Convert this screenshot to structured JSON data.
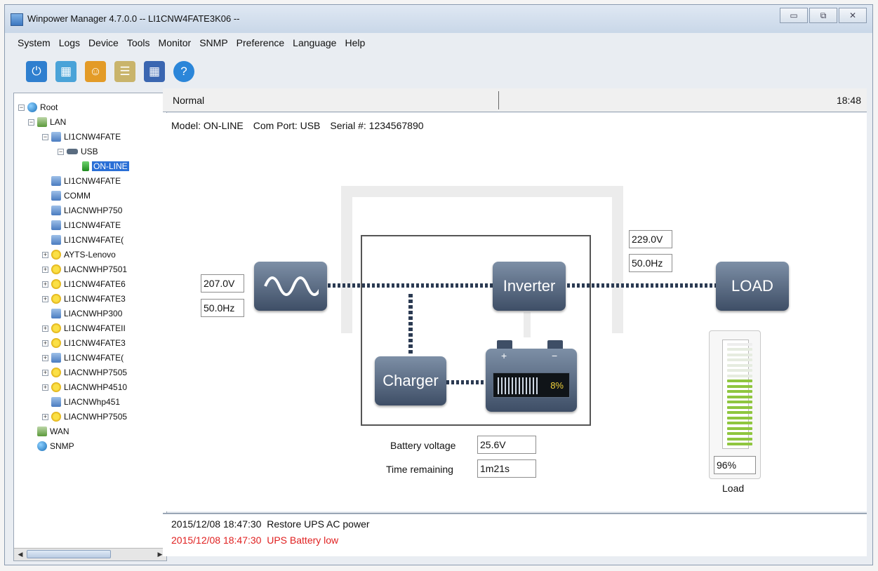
{
  "window": {
    "title": "Winpower Manager 4.7.0.0 -- LI1CNW4FATE3K06 --",
    "controls": [
      "▭",
      "⧉",
      "✕"
    ]
  },
  "menu": {
    "items": [
      "System",
      "Logs",
      "Device",
      "Tools",
      "Monitor",
      "SNMP",
      "Preference",
      "Language",
      "Help"
    ]
  },
  "toolbar": {
    "buttons": [
      {
        "icon": "power-icon",
        "glyph": "⏻",
        "color": "#2f7fcf"
      },
      {
        "icon": "calendar-clock-icon",
        "glyph": "▦",
        "color": "#4aa3d8"
      },
      {
        "icon": "user-icon",
        "glyph": "☺",
        "color": "#e39b27"
      },
      {
        "icon": "list-icon",
        "glyph": "☰",
        "color": "#c9b46b"
      },
      {
        "icon": "grid-icon",
        "glyph": "▦",
        "color": "#3a66b1"
      },
      {
        "icon": "help-icon",
        "glyph": "?",
        "color": "#2b86d9"
      }
    ]
  },
  "tree": {
    "nodes": [
      {
        "label": "Root",
        "exp": "⊟",
        "icon": "globe"
      },
      {
        "label": "LAN",
        "exp": "⊟",
        "icon": "net"
      },
      {
        "label": "LI1CNW4FATE",
        "exp": "⊟",
        "icon": "pc"
      },
      {
        "label": "USB",
        "exp": "⊟",
        "icon": "usb"
      },
      {
        "label": "ON-LINE",
        "exp": "",
        "icon": "green",
        "selected": true
      },
      {
        "label": "LI1CNW4FATE",
        "exp": "",
        "icon": "pc"
      },
      {
        "label": "COMM",
        "exp": "",
        "icon": "pc"
      },
      {
        "label": "LIACNWHP750",
        "exp": "",
        "icon": "pc"
      },
      {
        "label": "LI1CNW4FATE",
        "exp": "",
        "icon": "pc"
      },
      {
        "label": "LI1CNW4FATE(",
        "exp": "",
        "icon": "pc"
      },
      {
        "label": "AYTS-Lenovo",
        "exp": "⊞",
        "icon": "warn"
      },
      {
        "label": "LIACNWHP7501",
        "exp": "⊞",
        "icon": "warn"
      },
      {
        "label": "LI1CNW4FATE6",
        "exp": "⊞",
        "icon": "warn"
      },
      {
        "label": "LI1CNW4FATE3",
        "exp": "⊞",
        "icon": "warn"
      },
      {
        "label": "LIACNWHP300",
        "exp": "",
        "icon": "pc"
      },
      {
        "label": "LI1CNW4FATEII",
        "exp": "⊞",
        "icon": "warn"
      },
      {
        "label": "LI1CNW4FATE3",
        "exp": "⊞",
        "icon": "warn"
      },
      {
        "label": "LI1CNW4FATE(",
        "exp": "⊞",
        "icon": "pc"
      },
      {
        "label": "LIACNWHP7505",
        "exp": "⊞",
        "icon": "warn"
      },
      {
        "label": "LIACNWHP4510",
        "exp": "⊞",
        "icon": "warn"
      },
      {
        "label": "LIACNWhp451",
        "exp": "",
        "icon": "pc"
      },
      {
        "label": "LIACNWHP7505",
        "exp": "⊞",
        "icon": "warn"
      },
      {
        "label": "WAN",
        "exp": "",
        "icon": "net"
      },
      {
        "label": "SNMP",
        "exp": "",
        "icon": "globe"
      }
    ]
  },
  "status": {
    "state": "Normal",
    "time": "18:48"
  },
  "device_info": {
    "model": "Model: ON-LINE",
    "com_port": "Com Port: USB",
    "serial": "Serial #: 1234567890"
  },
  "diagram": {
    "input_voltage": "207.0V",
    "input_freq": "50.0Hz",
    "output_voltage": "229.0V",
    "output_freq": "50.0Hz",
    "inverter_label": "Inverter",
    "charger_label": "Charger",
    "load_label": "LOAD",
    "battery_percent": "8%",
    "battery_level": 0.08,
    "battery_plus": "+",
    "battery_minus": "−",
    "battery_voltage_label": "Battery voltage",
    "battery_voltage": "25.6V",
    "time_remaining_label": "Time remaining",
    "time_remaining": "1m21s",
    "load_percent": "96%",
    "load_level": 0.96,
    "load_caption": "Load"
  },
  "log": {
    "entries": [
      {
        "text": "2015/12/08 18:47:30  Restore UPS AC power",
        "color": "#111111"
      },
      {
        "text": "2015/12/08 18:47:30  UPS Battery low",
        "color": "#e02020"
      }
    ]
  }
}
